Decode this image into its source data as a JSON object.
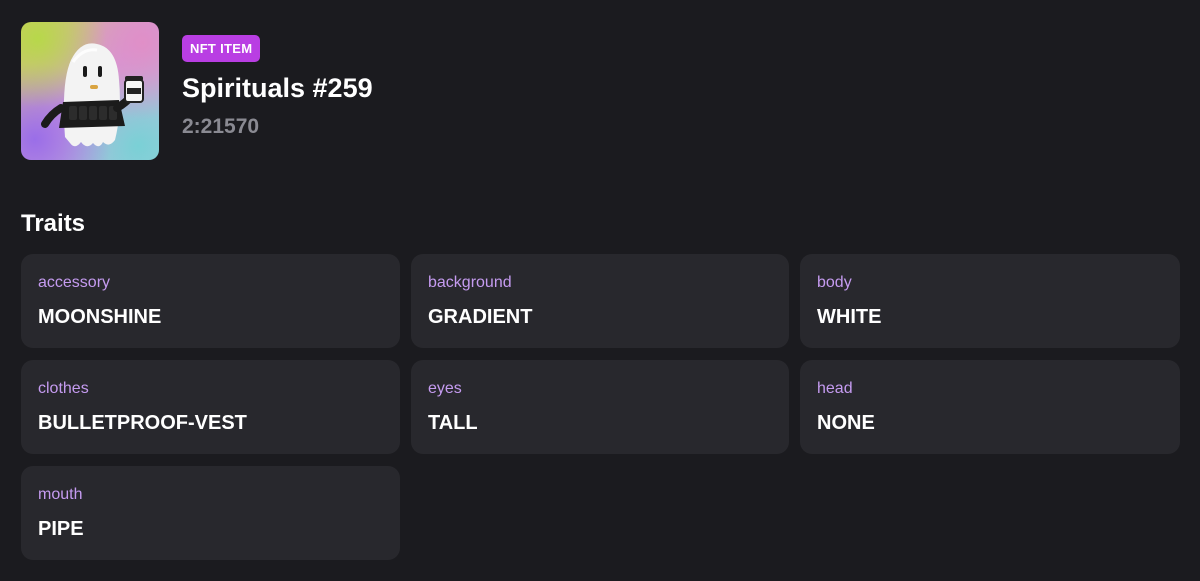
{
  "item": {
    "badge": "NFT ITEM",
    "name": "Spirituals #259",
    "id": "2:21570",
    "image_alt": "Spirituals ghost character with bulletproof vest holding a moonshine jar"
  },
  "traits": {
    "heading": "Traits",
    "items": [
      {
        "type": "accessory",
        "value": "MOONSHINE"
      },
      {
        "type": "background",
        "value": "GRADIENT"
      },
      {
        "type": "body",
        "value": "WHITE"
      },
      {
        "type": "clothes",
        "value": "BULLETPROOF-VEST"
      },
      {
        "type": "eyes",
        "value": "TALL"
      },
      {
        "type": "head",
        "value": "NONE"
      },
      {
        "type": "mouth",
        "value": "PIPE"
      }
    ]
  },
  "colors": {
    "background": "#1b1b1f",
    "card": "#28282d",
    "badge": "#b93ee3",
    "trait_type": "#c59bf0",
    "muted": "#8a8a92"
  }
}
